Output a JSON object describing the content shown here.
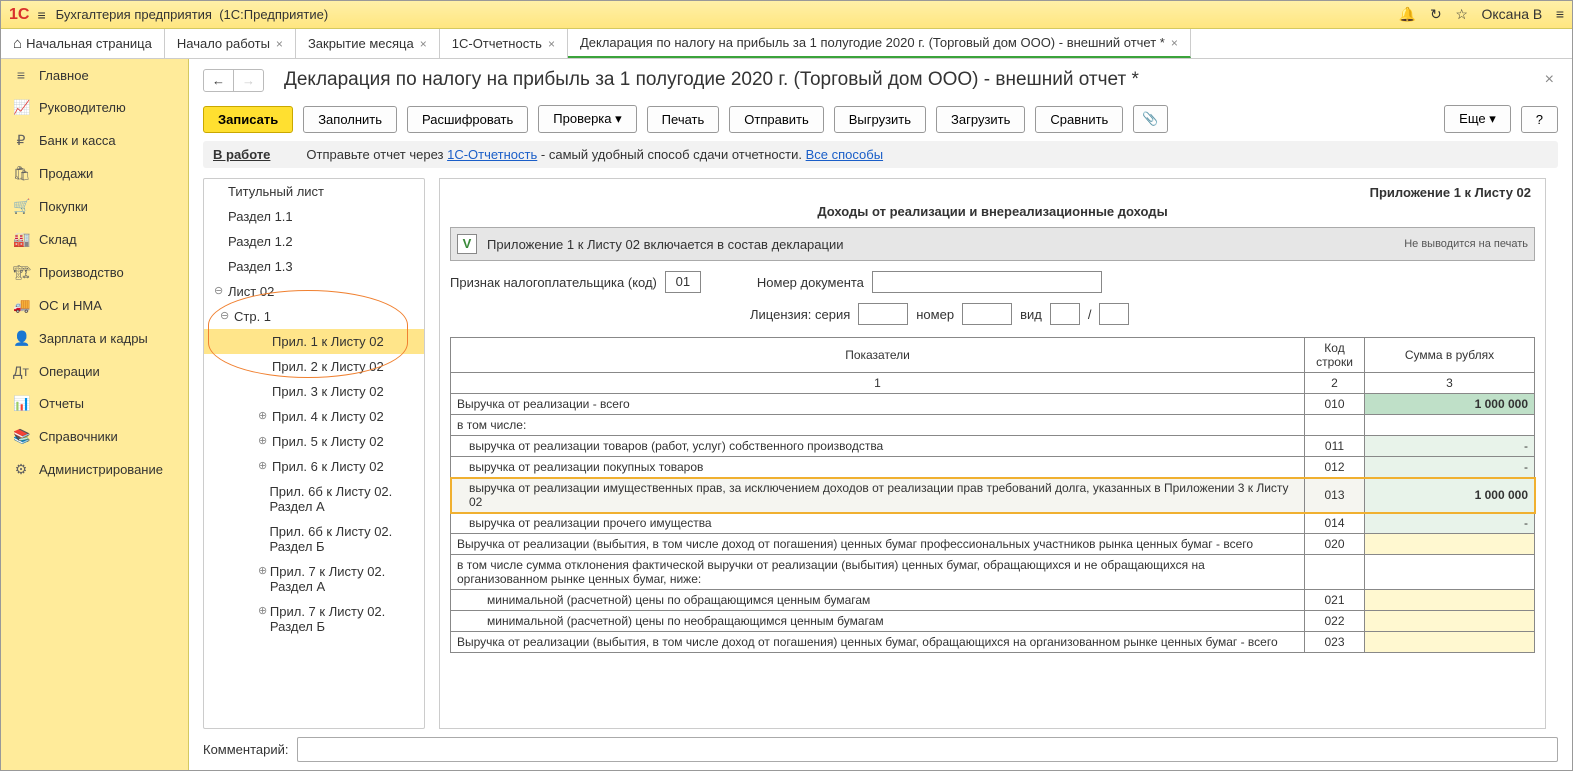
{
  "titlebar": {
    "app": "Бухгалтерия предприятия",
    "platform": "(1С:Предприятие)",
    "user": "Оксана В"
  },
  "tabs": {
    "home": "Начальная страница",
    "items": [
      {
        "label": "Начало работы"
      },
      {
        "label": "Закрытие месяца"
      },
      {
        "label": "1С-Отчетность"
      },
      {
        "label": "Декларация по налогу на прибыль за 1 полугодие 2020 г. (Торговый дом ООО) - внешний отчет *",
        "active": true
      }
    ]
  },
  "sidebar": [
    {
      "icon": "≡",
      "label": "Главное"
    },
    {
      "icon": "📈",
      "label": "Руководителю"
    },
    {
      "icon": "₽",
      "label": "Банк и касса"
    },
    {
      "icon": "🛍",
      "label": "Продажи"
    },
    {
      "icon": "🛒",
      "label": "Покупки"
    },
    {
      "icon": "🏭",
      "label": "Склад"
    },
    {
      "icon": "🏗",
      "label": "Производство"
    },
    {
      "icon": "🚚",
      "label": "ОС и НМА"
    },
    {
      "icon": "👤",
      "label": "Зарплата и кадры"
    },
    {
      "icon": "Дт",
      "label": "Операции"
    },
    {
      "icon": "📊",
      "label": "Отчеты"
    },
    {
      "icon": "📚",
      "label": "Справочники"
    },
    {
      "icon": "⚙",
      "label": "Администрирование"
    }
  ],
  "doc": {
    "title": "Декларация по налогу на прибыль за 1 полугодие 2020 г. (Торговый дом ООО) - внешний отчет *",
    "toolbar": {
      "save": "Записать",
      "fill": "Заполнить",
      "decode": "Расшифровать",
      "check": "Проверка",
      "print": "Печать",
      "send": "Отправить",
      "export": "Выгрузить",
      "import": "Загрузить",
      "compare": "Сравнить",
      "more": "Еще",
      "help": "?"
    },
    "status": {
      "label": "В работе",
      "text1": "Отправьте отчет через ",
      "link1": "1С-Отчетность",
      "text2": " - самый удобный способ сдачи отчетности. ",
      "link2": "Все способы"
    },
    "tree": [
      {
        "label": "Титульный лист",
        "level": 0
      },
      {
        "label": "Раздел 1.1",
        "level": 0
      },
      {
        "label": "Раздел 1.2",
        "level": 0
      },
      {
        "label": "Раздел 1.3",
        "level": 0
      },
      {
        "label": "Лист 02",
        "level": 0,
        "toggle": "⊖"
      },
      {
        "label": "Стр. 1",
        "level": 1,
        "toggle": "⊖"
      },
      {
        "label": "Прил. 1 к Листу 02",
        "level": 3,
        "selected": true
      },
      {
        "label": "Прил. 2 к Листу 02",
        "level": 3
      },
      {
        "label": "Прил. 3 к Листу 02",
        "level": 3
      },
      {
        "label": "Прил. 4 к Листу 02",
        "level": 3,
        "toggle": "⊕"
      },
      {
        "label": "Прил. 5 к Листу 02",
        "level": 3,
        "toggle": "⊕"
      },
      {
        "label": "Прил. 6 к Листу 02",
        "level": 3,
        "toggle": "⊕"
      },
      {
        "label": "Прил. 6б к Листу 02. Раздел А",
        "level": 3
      },
      {
        "label": "Прил. 6б к Листу 02. Раздел Б",
        "level": 3
      },
      {
        "label": "Прил. 7 к Листу 02. Раздел А",
        "level": 3,
        "toggle": "⊕"
      },
      {
        "label": "Прил. 7 к Листу 02. Раздел Б",
        "level": 3,
        "toggle": "⊕"
      }
    ],
    "form": {
      "header": "Приложение 1 к Листу 02",
      "subheader": "Доходы от реализации и внереализационные доходы",
      "incl_mark": "V",
      "incl_text": "Приложение 1 к Листу 02 включается в состав декларации",
      "incl_note": "Не выводится на печать",
      "meta": {
        "tax_label": "Признак налогоплательщика (код)",
        "tax_code": "01",
        "docnum_label": "Номер документа",
        "lic_label": "Лицензия: серия",
        "lic_num_label": "номер",
        "lic_kind_label": "вид",
        "lic_slash": "/"
      },
      "th": {
        "ind": "Показатели",
        "code": "Код строки",
        "sum": "Сумма в рублях",
        "n1": "1",
        "n2": "2",
        "n3": "3"
      },
      "rows": [
        {
          "label": "Выручка от реализации - всего",
          "code": "010",
          "sum": "1 000 000",
          "cls": "green"
        },
        {
          "label": "в том числе:",
          "code": "",
          "sum": "",
          "cls": ""
        },
        {
          "label": "выручка от реализации товаров (работ, услуг) собственного производства",
          "code": "011",
          "sum": "-",
          "cls": "lightgreen",
          "indent": 1
        },
        {
          "label": "выручка от реализации покупных товаров",
          "code": "012",
          "sum": "-",
          "cls": "lightgreen",
          "indent": 1
        },
        {
          "label": "выручка от реализации имущественных прав, за исключением доходов от реализации прав требований долга, указанных в Приложении 3 к Листу 02",
          "code": "013",
          "sum": "1 000 000",
          "cls": "lightgreen hl",
          "indent": 1,
          "bold": true
        },
        {
          "label": "выручка от реализации прочего имущества",
          "code": "014",
          "sum": "-",
          "cls": "lightgreen",
          "indent": 1
        },
        {
          "label": "Выручка от реализации (выбытия, в том числе доход от погашения) ценных бумаг профессиональных участников рынка ценных бумаг - всего",
          "code": "020",
          "sum": "",
          "cls": "yellow"
        },
        {
          "label": "в том числе сумма отклонения фактической выручки от реализации (выбытия) ценных бумаг, обращающихся и не обращающихся на организованном рынке ценных бумаг, ниже:",
          "code": "",
          "sum": "",
          "cls": ""
        },
        {
          "label": "минимальной (расчетной) цены по обращающимся ценным бумагам",
          "code": "021",
          "sum": "",
          "cls": "yellow",
          "indent": 2
        },
        {
          "label": "минимальной (расчетной) цены по необращающимся ценным бумагам",
          "code": "022",
          "sum": "",
          "cls": "yellow",
          "indent": 2
        },
        {
          "label": "Выручка от реализации (выбытия, в том числе доход от погашения) ценных бумаг, обращающихся на организованном рынке ценных бумаг - всего",
          "code": "023",
          "sum": "",
          "cls": "yellow"
        }
      ]
    },
    "comment_label": "Комментарий:"
  }
}
